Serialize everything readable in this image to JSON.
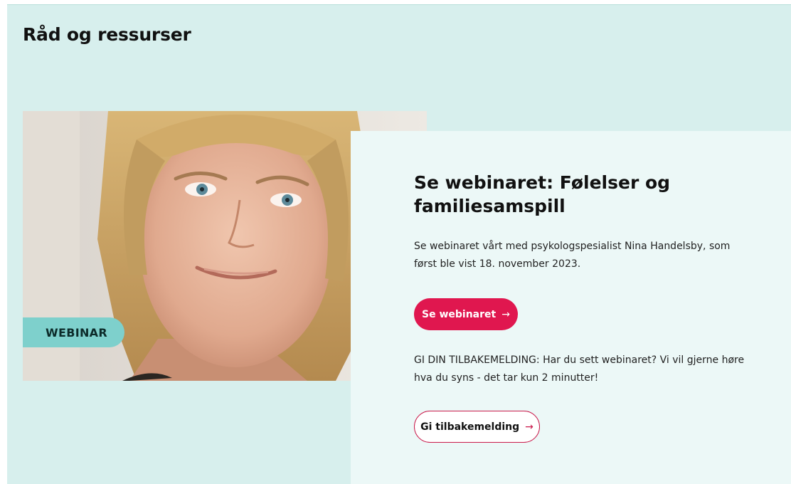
{
  "section": {
    "title": "Råd og ressurser"
  },
  "media": {
    "tag": "WEBINAR",
    "photo_alt": "portrait-photo"
  },
  "card": {
    "title": "Se webinaret: Følelser og familiesamspill",
    "description": "Se webinaret vårt med psykologspesialist Nina Handelsby, som først ble vist 18. november 2023.",
    "primary_button": {
      "label": "Se webinaret",
      "arrow": "→"
    },
    "feedback_text": "GI DIN TILBAKEMELDING: Har du sett webinaret? Vi vil gjerne høre hva du syns - det tar kun 2 minutter!",
    "secondary_button": {
      "label": "Gi tilbakemelding",
      "arrow": "→"
    }
  },
  "colors": {
    "section_bg": "#d7efed",
    "card_bg": "#ecf8f7",
    "accent": "#e0174f",
    "tag_bg": "#7ed0cc"
  }
}
